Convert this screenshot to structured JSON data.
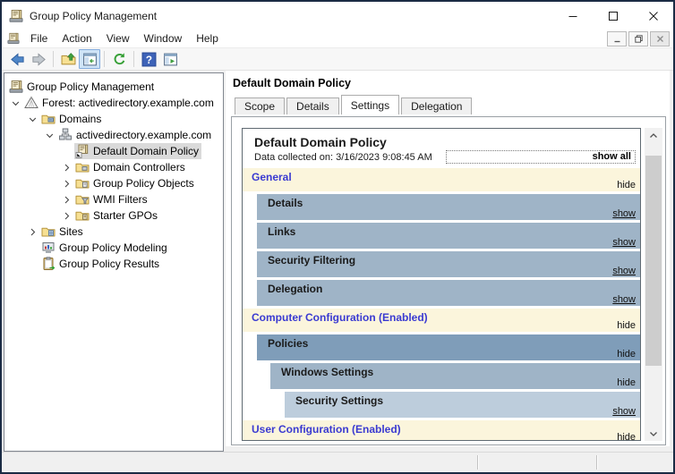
{
  "window": {
    "title": "Group Policy Management"
  },
  "menubar": {
    "items": [
      "File",
      "Action",
      "View",
      "Window",
      "Help"
    ],
    "mdi_controls": [
      "minimize",
      "restore",
      "close"
    ]
  },
  "toolbar": {
    "buttons": [
      {
        "icon": "back-arrow-icon"
      },
      {
        "icon": "forward-arrow-icon"
      },
      {
        "sep": true
      },
      {
        "icon": "up-one-level-icon"
      },
      {
        "icon": "console-tree-toggle-icon",
        "active": true
      },
      {
        "sep": true
      },
      {
        "icon": "refresh-icon"
      },
      {
        "sep": true
      },
      {
        "icon": "help-icon"
      },
      {
        "icon": "console-window-icon"
      }
    ]
  },
  "tree": {
    "items": [
      {
        "label": "Group Policy Management",
        "level": 0,
        "toggle": "none",
        "icon": "gpm-console-icon"
      },
      {
        "label": "Forest: activedirectory.example.com",
        "level": 1,
        "toggle": "expanded",
        "icon": "forest-icon"
      },
      {
        "label": "Domains",
        "level": 2,
        "toggle": "expanded",
        "icon": "domains-folder-icon"
      },
      {
        "label": "activedirectory.example.com",
        "level": 3,
        "toggle": "expanded",
        "icon": "domain-icon"
      },
      {
        "label": "Default Domain Policy",
        "level": 4,
        "toggle": "none",
        "icon": "gpo-link-icon",
        "selected": true
      },
      {
        "label": "Domain Controllers",
        "level": 4,
        "toggle": "collapsed",
        "icon": "folder-domain-controllers-icon"
      },
      {
        "label": "Group Policy Objects",
        "level": 4,
        "toggle": "collapsed",
        "icon": "folder-gpo-icon"
      },
      {
        "label": "WMI Filters",
        "level": 4,
        "toggle": "collapsed",
        "icon": "folder-wmi-filters-icon"
      },
      {
        "label": "Starter GPOs",
        "level": 4,
        "toggle": "collapsed",
        "icon": "folder-starter-gpos-icon"
      },
      {
        "label": "Sites",
        "level": 2,
        "toggle": "collapsed",
        "icon": "folder-sites-icon"
      },
      {
        "label": "Group Policy Modeling",
        "level": 2,
        "toggle": "none",
        "icon": "gp-modeling-icon"
      },
      {
        "label": "Group Policy Results",
        "level": 2,
        "toggle": "none",
        "icon": "gp-results-icon"
      }
    ]
  },
  "content": {
    "header_title": "Default Domain Policy",
    "tabs": [
      {
        "label": "Scope"
      },
      {
        "label": "Details"
      },
      {
        "label": "Settings",
        "active": true
      },
      {
        "label": "Delegation"
      }
    ],
    "report": {
      "title": "Default Domain Policy",
      "collected_text": "Data collected on: 3/16/2023 9:08:45 AM",
      "show_all_label": "show all",
      "sections": [
        {
          "label": "General",
          "style": "group",
          "indent": 0,
          "action": "hide"
        },
        {
          "label": "Details",
          "style": "bar",
          "indent": 1,
          "action": "show"
        },
        {
          "label": "Links",
          "style": "bar",
          "indent": 1,
          "action": "show"
        },
        {
          "label": "Security Filtering",
          "style": "bar",
          "indent": 1,
          "action": "show"
        },
        {
          "label": "Delegation",
          "style": "bar",
          "indent": 1,
          "action": "show"
        },
        {
          "label": "Computer Configuration (Enabled)",
          "style": "group",
          "indent": 0,
          "action": "hide"
        },
        {
          "label": "Policies",
          "style": "bar-dark",
          "indent": 1,
          "action": "hide"
        },
        {
          "label": "Windows Settings",
          "style": "bar",
          "indent": 2,
          "action": "hide"
        },
        {
          "label": "Security Settings",
          "style": "bar-light",
          "indent": 3,
          "action": "show"
        },
        {
          "label": "User Configuration (Enabled)",
          "style": "group",
          "indent": 0,
          "action": "hide"
        }
      ]
    }
  },
  "statusbar": {
    "divider_positions": [
      531,
      664
    ]
  },
  "colors": {
    "accent_border": "#1B2B44",
    "section_header_bg": "#FBF5DC",
    "section_header_text": "#3A3AD1",
    "bar_bg": "#9FB4C7",
    "bar_dark_bg": "#7F9DB9",
    "bar_light_bg": "#BDCDDC",
    "tree_selection_bg": "#DADADA",
    "toolbar_active_bg": "#CFE4F7",
    "toolbar_active_border": "#84ACDD"
  }
}
